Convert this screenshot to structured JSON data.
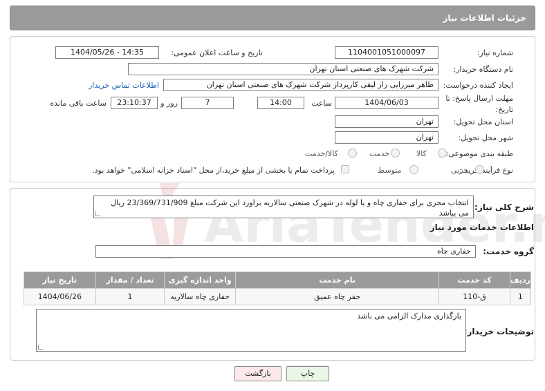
{
  "header": {
    "title": "جزئیات اطلاعات نیاز"
  },
  "info": {
    "need_number_label": "شماره نیاز:",
    "need_number": "1104001051000097",
    "announce_label": "تاریخ و ساعت اعلان عمومی:",
    "announce_value": "1404/05/26 - 14:35",
    "buyer_org_label": "نام دستگاه خریدار:",
    "buyer_org": "شرکت شهرک های صنعتی استان تهران",
    "creator_label": "ایجاد کننده درخواست:",
    "creator": "طاهر  میرزایی راز لیقی کارپرداز شرکت شهرک های صنعتی استان تهران",
    "contact_link": "اطلاعات تماس خریدار",
    "deadline_label_line1": "مهلت ارسال پاسخ: تا",
    "deadline_label_line2": "تاریخ:",
    "deadline_date": "1404/06/03",
    "time_label": "ساعت",
    "deadline_time": "14:00",
    "days_value": "7",
    "days_label": "روز و",
    "remaining_time": "23:10:37",
    "remaining_label": "ساعت باقی مانده",
    "province_label": "استان محل تحویل:",
    "province": "تهران",
    "city_label": "شهر محل تحویل:",
    "city": "تهران",
    "category_label": "طبقه بندی موضوعی:",
    "category_options": [
      "کالا",
      "خدمت",
      "کالا/خدمت"
    ],
    "process_label": "نوع فرآیند خرید :",
    "process_options": [
      "جزیی",
      "متوسط"
    ],
    "payment_note": "پرداخت تمام یا بخشی از مبلغ خرید،از محل \"اسناد خزانه اسلامی\" خواهد بود."
  },
  "details": {
    "summary_label": "شرح کلی نیاز:",
    "summary_text": "انتخاب مجری برای حفاری چاه و با لوله در شهرک صنعتی سالاریه براورد این شرکت مبلغ 23/369/731/909 ریال می بباشد",
    "services_title": "اطلاعات خدمات مورد نیاز",
    "service_group_label": "گروه خدمت:",
    "service_group": "حفاری چاه",
    "table": {
      "headers": [
        "ردیف",
        "کد خدمت",
        "نام خدمت",
        "واحد اندازه گیری",
        "تعداد / مقدار",
        "تاریخ نیاز"
      ],
      "rows": [
        [
          "1",
          "ق-110",
          "حفر چاه عمیق",
          "حفاری چاه سالاریه",
          "1",
          "1404/06/26"
        ]
      ]
    },
    "buyer_notes_label": "توضیحات خریدار:",
    "buyer_notes": "بارگذاری مدارک الزامی می باشد"
  },
  "buttons": {
    "print": "چاپ",
    "back": "بازگشت"
  },
  "watermark": {
    "text": "AriaTender.neT"
  },
  "colors": {
    "header_bg": "#9a9a9a",
    "link": "#1a5fb4",
    "back_button_bg": "#fde8ea",
    "print_button_bg": "#eaf7e6"
  }
}
